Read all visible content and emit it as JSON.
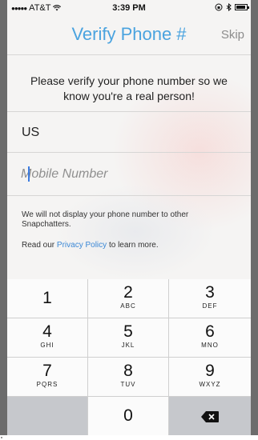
{
  "status_bar": {
    "carrier": "AT&T",
    "time": "3:39 PM"
  },
  "nav": {
    "title": "Verify Phone #",
    "skip_label": "Skip"
  },
  "message": "Please verify your phone number so we know you're a real person!",
  "country": "US",
  "mobile_input": {
    "placeholder": "Mobile Number",
    "value": ""
  },
  "notice": "We will not display your phone number to other Snapchatters.",
  "policy": {
    "prefix": "Read our ",
    "link": "Privacy Policy",
    "suffix": " to learn more."
  },
  "keypad": {
    "keys": [
      {
        "num": "1",
        "letters": ""
      },
      {
        "num": "2",
        "letters": "ABC"
      },
      {
        "num": "3",
        "letters": "DEF"
      },
      {
        "num": "4",
        "letters": "GHI"
      },
      {
        "num": "5",
        "letters": "JKL"
      },
      {
        "num": "6",
        "letters": "MNO"
      },
      {
        "num": "7",
        "letters": "PQRS"
      },
      {
        "num": "8",
        "letters": "TUV"
      },
      {
        "num": "9",
        "letters": "WXYZ"
      },
      {
        "num": "0",
        "letters": ""
      }
    ],
    "delete_icon": "backspace-icon"
  },
  "colors": {
    "accent": "#4aa3df",
    "link": "#3b88d6"
  }
}
